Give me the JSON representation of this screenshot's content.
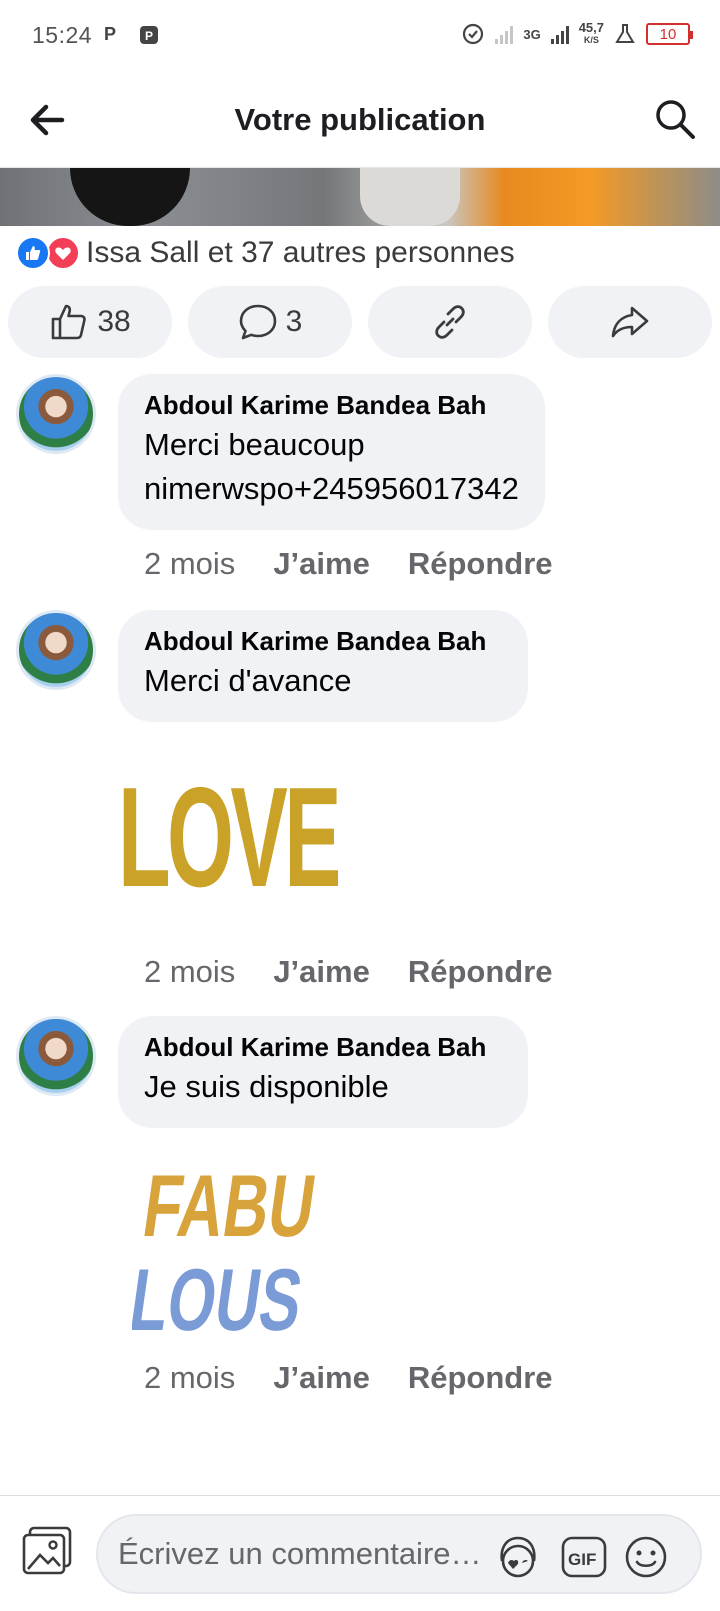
{
  "status_bar": {
    "time": "15:24",
    "left_icons": [
      "parking-icon",
      "app-icon"
    ],
    "network": "3G",
    "speed": "45,7",
    "speed_unit": "K/S",
    "battery": "10"
  },
  "header": {
    "title": "Votre publication"
  },
  "reactions": {
    "summary": "Issa Sall et 37 autres personnes"
  },
  "actions": {
    "like_count": "38",
    "comment_count": "3"
  },
  "comments": [
    {
      "author": "Abdoul Karime Bandea Bah",
      "text_line1": "Merci beaucoup",
      "text_line2": "nimerwspo+245956017342",
      "time": "2 mois",
      "like_label": "J’aime",
      "reply_label": "Répondre"
    },
    {
      "author": "Abdoul Karime Bandea Bah",
      "text": "Merci d'avance",
      "sticker": "LOVE",
      "time": "2 mois",
      "like_label": "J’aime",
      "reply_label": "Répondre"
    },
    {
      "author": "Abdoul Karime Bandea Bah",
      "text": "Je suis disponible",
      "sticker_line1": "FABU",
      "sticker_line2": "LOUS",
      "time": "2 mois",
      "like_label": "J’aime",
      "reply_label": "Répondre"
    }
  ],
  "composer": {
    "placeholder": "Écrivez un commentaire…",
    "gif_label": "GIF"
  },
  "colors": {
    "facebook_blue": "#1877f2",
    "love_red": "#f33e58",
    "bubble_gray": "#f0f2f5",
    "battery_red": "#d32f2f"
  }
}
